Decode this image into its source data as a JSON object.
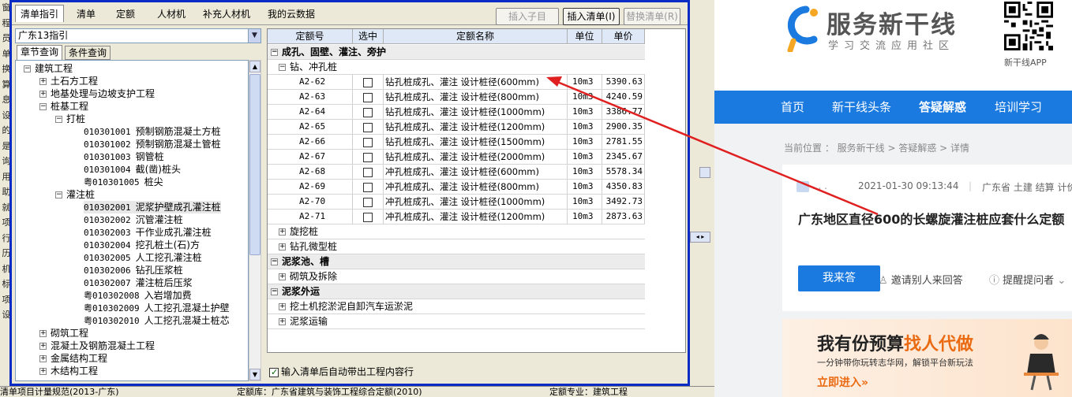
{
  "background": {
    "left_strip": [
      "窗",
      "程",
      "员",
      "单",
      "换",
      "算",
      "息",
      "设",
      "的",
      "是",
      "询",
      "用",
      "助",
      "就",
      "项",
      "行",
      "历",
      "机",
      "标",
      "项",
      "设"
    ],
    "status": [
      "清单项目计量规范(2013-广东)",
      "定额库：广东省建筑与装饰工程综合定额(2010)",
      "定额专业：建筑工程"
    ]
  },
  "dialog": {
    "tabs": [
      "清单指引",
      "清单",
      "定额",
      "人材机",
      "补充人材机",
      "我的云数据"
    ],
    "buttons": {
      "insert_child": "插入子目",
      "insert_bill": "插入清单(I)",
      "replace_bill": "替换清单(R)"
    },
    "standard_select": "广东13指引",
    "subtabs": [
      "章节查询",
      "条件查询"
    ],
    "tree": {
      "root": "建筑工程",
      "earthwork": "土石方工程",
      "foundation": "地基处理与边坡支护工程",
      "pile": "桩基工程",
      "driven": "打桩",
      "driven_items": [
        {
          "code": "010301001",
          "name": "预制钢筋混凝土方桩"
        },
        {
          "code": "010301002",
          "name": "预制钢筋混凝土管桩"
        },
        {
          "code": "010301003",
          "name": "钢管桩"
        },
        {
          "code": "010301004",
          "name": "截(凿)桩头"
        },
        {
          "code": "粤010301005",
          "name": "桩尖"
        }
      ],
      "bored": "灌注桩",
      "bored_items": [
        {
          "code": "010302001",
          "name": "泥浆护壁成孔灌注桩"
        },
        {
          "code": "010302002",
          "name": "沉管灌注桩"
        },
        {
          "code": "010302003",
          "name": "干作业成孔灌注桩"
        },
        {
          "code": "010302004",
          "name": "挖孔桩土(石)方"
        },
        {
          "code": "010302005",
          "name": "人工挖孔灌注桩"
        },
        {
          "code": "010302006",
          "name": "钻孔压浆桩"
        },
        {
          "code": "010302007",
          "name": "灌注桩后压浆"
        },
        {
          "code": "粤010302008",
          "name": "入岩增加费"
        },
        {
          "code": "粤010302009",
          "name": "人工挖孔混凝土护壁"
        },
        {
          "code": "粤010302010",
          "name": "人工挖孔混凝土桩芯"
        }
      ],
      "others": [
        "砌筑工程",
        "混凝土及钢筋混凝土工程",
        "金属结构工程",
        "木结构工程"
      ]
    },
    "grid": {
      "headers": {
        "code": "定额号",
        "select": "选中",
        "name": "定额名称",
        "unit": "单位",
        "price": "单价"
      },
      "section1": "成孔、固壁、灌注、旁护",
      "group_drill": "钻、冲孔桩",
      "rows": [
        {
          "code": "A2-62",
          "name": "钻孔桩成孔、灌注 设计桩径(600mm)",
          "unit": "10m3",
          "price": "5390.63"
        },
        {
          "code": "A2-63",
          "name": "钻孔桩成孔、灌注 设计桩径(800mm)",
          "unit": "10m3",
          "price": "4240.59"
        },
        {
          "code": "A2-64",
          "name": "钻孔桩成孔、灌注 设计桩径(1000mm)",
          "unit": "10m3",
          "price": "3386.77"
        },
        {
          "code": "A2-65",
          "name": "钻孔桩成孔、灌注 设计桩径(1200mm)",
          "unit": "10m3",
          "price": "2900.35"
        },
        {
          "code": "A2-66",
          "name": "钻孔桩成孔、灌注 设计桩径(1500mm)",
          "unit": "10m3",
          "price": "2781.55"
        },
        {
          "code": "A2-67",
          "name": "钻孔桩成孔、灌注 设计桩径(2000mm)",
          "unit": "10m3",
          "price": "2345.67"
        },
        {
          "code": "A2-68",
          "name": "冲孔桩成孔、灌注 设计桩径(600mm)",
          "unit": "10m3",
          "price": "5578.34"
        },
        {
          "code": "A2-69",
          "name": "冲孔桩成孔、灌注 设计桩径(800mm)",
          "unit": "10m3",
          "price": "4350.83"
        },
        {
          "code": "A2-70",
          "name": "冲孔桩成孔、灌注 设计桩径(1000mm)",
          "unit": "10m3",
          "price": "3492.73"
        },
        {
          "code": "A2-71",
          "name": "冲孔桩成孔、灌注 设计桩径(1200mm)",
          "unit": "10m3",
          "price": "2873.63"
        }
      ],
      "group_rotary": "旋挖桩",
      "group_micro": "钻孔微型桩",
      "section2": "泥浆池、槽",
      "group_masonry": "砌筑及拆除",
      "section3": "泥浆外运",
      "group_excavator": "挖土机挖淤泥自卸汽车运淤泥",
      "group_mud": "泥浆运输"
    },
    "auto_option": "输入清单后自动带出工程内容行"
  },
  "website": {
    "logo_title": "服务新干线",
    "logo_sub": "学习交流应用社区",
    "qr_label": "新干线APP",
    "nav": [
      "首页",
      "新干线头条",
      "答疑解惑",
      "培训学习"
    ],
    "breadcrumb": "当前位置 ： 服务新干线 > 答疑解惑 > 详情",
    "meta_date": "2021-01-30 09:13:44",
    "meta_tags": "广东省 土建 结算 计价",
    "question_title": "广东地区直径600的长螺旋灌注桩应套什么定额",
    "answer_button": "我来答",
    "invite": "邀请别人来回答",
    "remind": "提醒提问者",
    "banner_title_pre": "我有份预算",
    "banner_title_hl": "找人代做",
    "banner_sub": "一分钟带你玩转志华网，解锁平台新玩法",
    "banner_cta": "立即进入»",
    "colors": {
      "brand_blue": "#1a7ae0",
      "accent_orange": "#ea6a12"
    }
  },
  "annotation": {
    "color": "#e02020"
  }
}
